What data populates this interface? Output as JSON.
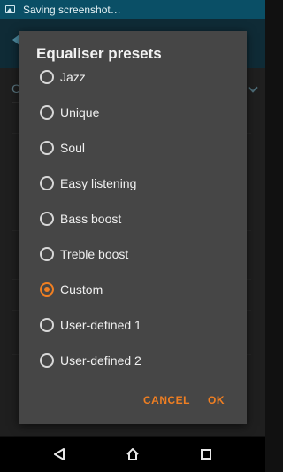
{
  "status_bar": {
    "notification_text": "Saving screenshot…"
  },
  "dialog": {
    "title": "Equaliser presets",
    "options": [
      {
        "label": "Jazz",
        "selected": false
      },
      {
        "label": "Unique",
        "selected": false
      },
      {
        "label": "Soul",
        "selected": false
      },
      {
        "label": "Easy listening",
        "selected": false
      },
      {
        "label": "Bass boost",
        "selected": false
      },
      {
        "label": "Treble boost",
        "selected": false
      },
      {
        "label": "Custom",
        "selected": true
      },
      {
        "label": "User-defined 1",
        "selected": false
      },
      {
        "label": "User-defined 2",
        "selected": false
      }
    ],
    "cancel_label": "CANCEL",
    "ok_label": "OK"
  },
  "colors": {
    "accent": "#f07f22",
    "dialog_bg": "#464646",
    "status_bar_bg": "#0a4f66"
  },
  "icons": {
    "status": "screenshot-image-icon",
    "nav_back": "triangle-back-icon",
    "nav_home": "home-icon",
    "nav_recents": "square-recents-icon"
  }
}
